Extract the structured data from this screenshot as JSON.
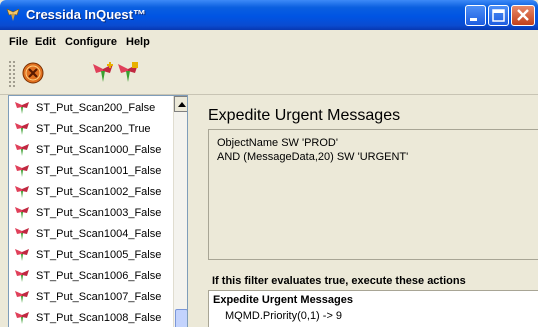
{
  "window": {
    "title": "Cressida InQuest™"
  },
  "menu": [
    "File",
    "Edit",
    "Configure",
    "Help"
  ],
  "toolbar": {
    "buttons": [
      "stop-icon",
      "add-filter-icon",
      "edit-filter-icon"
    ]
  },
  "filters": [
    "ST_Put_Scan200_False",
    "ST_Put_Scan200_True",
    "ST_Put_Scan1000_False",
    "ST_Put_Scan1001_False",
    "ST_Put_Scan1002_False",
    "ST_Put_Scan1003_False",
    "ST_Put_Scan1004_False",
    "ST_Put_Scan1005_False",
    "ST_Put_Scan1006_False",
    "ST_Put_Scan1007_False",
    "ST_Put_Scan1008_False"
  ],
  "detail": {
    "title": "Expedite Urgent Messages",
    "expression": [
      "ObjectName SW 'PROD'",
      "AND (MessageData,20) SW 'URGENT'"
    ],
    "actions_heading": "If this filter evaluates true, execute these actions",
    "action_title": "Expedite Urgent Messages",
    "action_lines": [
      "MQMD.Priority(0,1) -> 9"
    ]
  },
  "colors": {
    "titlebar": "#0054e3",
    "window_bg": "#ece9d8",
    "list_border": "#7f9db9"
  }
}
